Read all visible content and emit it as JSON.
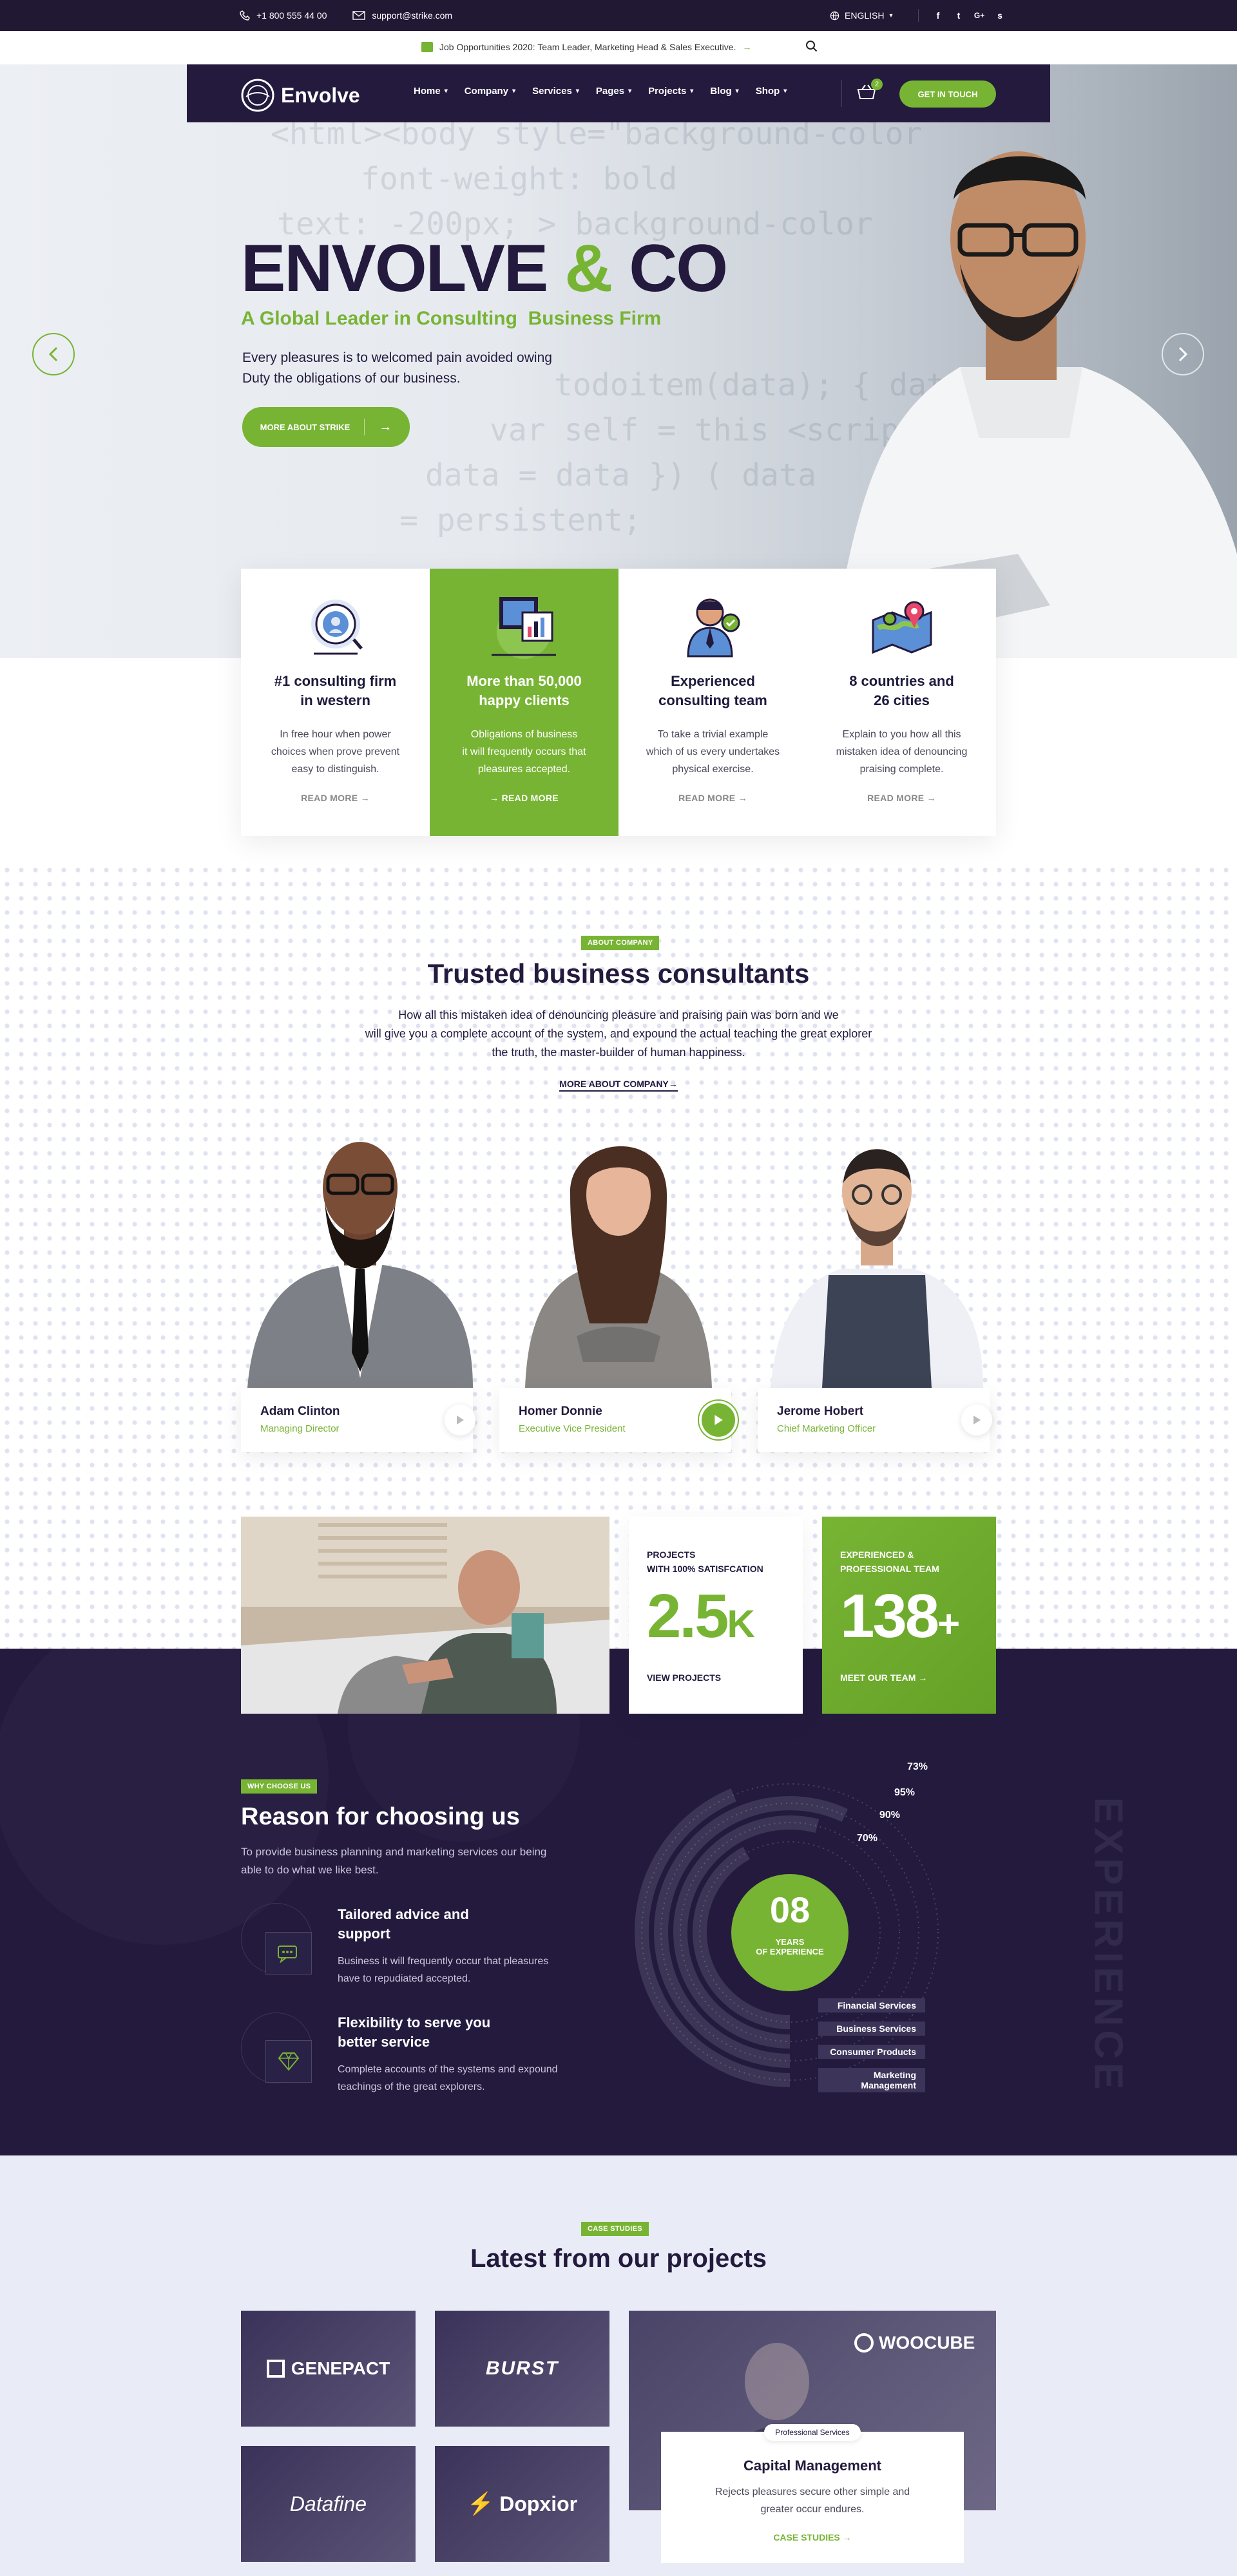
{
  "topbar": {
    "phone": "+1 800 555 44 00",
    "email": "support@strike.com",
    "language": "ENGLISH",
    "socials": [
      "f",
      "t",
      "G+",
      "s"
    ]
  },
  "announcement": {
    "text": "Job Opportunities 2020: Team Leader, Marketing Head & Sales Executive.",
    "arrow": "→"
  },
  "nav": {
    "logo": "Envolve",
    "items": [
      "Home",
      "Company",
      "Services",
      "Pages",
      "Projects",
      "Blog",
      "Shop"
    ],
    "cart_count": "2",
    "cta": "GET IN TOUCH"
  },
  "hero": {
    "title_a": "ENVOLVE",
    "title_amp": "&",
    "title_b": "CO",
    "subtitle": "A Global Leader in Consulting  Business Firm",
    "text1": "Every pleasures is to welcomed pain avoided owing",
    "text2": "Duty the obligations of our business.",
    "button": "MORE ABOUT STRIKE",
    "code_lines": [
      "<html><body style=\"background-color",
      "font-weight: bold",
      "text: -200px; > background-color",
      "todoitem(data); { data: }",
      "var  self = this <script/>",
      "data = data }) ( data",
      "= persistent;"
    ]
  },
  "features": [
    {
      "title1": "#1 consulting firm",
      "title2": "in western",
      "p1": "In free hour when power",
      "p2": "choices when prove prevent",
      "p3": "easy to distinguish.",
      "link": "READ MORE",
      "icon": "target-search-icon"
    },
    {
      "title1": "More than 50,000",
      "title2": "happy clients",
      "p1": "Obligations of business",
      "p2": "it will frequently occurs that",
      "p3": "pleasures accepted.",
      "link": "READ MORE",
      "icon": "dashboard-icon"
    },
    {
      "title1": "Experienced",
      "title2": "consulting team",
      "p1": "To take a trivial example",
      "p2": "which of us every undertakes",
      "p3": "physical exercise.",
      "link": "READ MORE",
      "icon": "consultant-icon"
    },
    {
      "title1": "8 countries and",
      "title2": "26 cities",
      "p1": "Explain to you how all this",
      "p2": "mistaken idea of denouncing",
      "p3": "praising complete.",
      "link": "READ MORE",
      "icon": "map-pin-icon"
    }
  ],
  "about": {
    "tag": "ABOUT COMPANY",
    "title": "Trusted business consultants",
    "text1": "How all this mistaken idea of denouncing pleasure and praising pain was born and we",
    "text2": "will give you a complete account of the system, and expound the actual teaching the great explorer",
    "text3": "the truth, the master-builder of human happiness.",
    "link": "MORE ABOUT COMPANY→"
  },
  "team": [
    {
      "name": "Adam Clinton",
      "role": "Managing Director"
    },
    {
      "name": "Homer Donnie",
      "role": "Executive Vice President"
    },
    {
      "name": "Jerome Hobert",
      "role": "Chief Marketing Officer"
    }
  ],
  "stats": {
    "projects_label1": "PROJECTS",
    "projects_label2": "WITH 100% SATISFCATION",
    "projects_value": "2.5",
    "projects_suffix": "K",
    "projects_link": "VIEW PROJECTS",
    "team_label1": "EXPERIENCED &",
    "team_label2": "PROFESSIONAL TEAM",
    "team_value": "138",
    "team_suffix": "+",
    "team_link": "MEET OUR TEAM →"
  },
  "why": {
    "tag": "WHY CHOOSE US",
    "title": "Reason for choosing us",
    "text1": "To provide business planning and marketing services our being",
    "text2": "able to do what we like best.",
    "items": [
      {
        "t1": "Tailored advice and",
        "t2": "support",
        "d1": "Business it will frequently occur that pleasures",
        "d2": "have to repudiated accepted.",
        "icon": "chat-icon"
      },
      {
        "t1": "Flexibility to serve you",
        "t2": "better service",
        "d1": "Complete accounts of the systems and expound",
        "d2": "teachings of the great explorers.",
        "icon": "diamond-icon"
      }
    ],
    "experience_number": "08",
    "experience_label1": "YEARS",
    "experience_label2": "OF EXPERIENCE",
    "watermark": "EXPERIENCE",
    "rings": [
      {
        "percent": "73%",
        "label": "Financial Services",
        "value": 0.73
      },
      {
        "percent": "95%",
        "label": "Business Services",
        "value": 0.95
      },
      {
        "percent": "90%",
        "label": "Consumer Products",
        "value": 0.9
      },
      {
        "percent": "70%",
        "label": "Marketing Management",
        "value": 0.7
      }
    ]
  },
  "projects": {
    "tag": "CASE STUDIES",
    "title": "Latest from our projects",
    "logos": [
      "GENEPACT",
      "BURST",
      "Datafine",
      "Dopxior"
    ],
    "featured_logo": "WOOCUBE",
    "featured_tag": "Professional Services",
    "featured_title": "Capital Management",
    "featured_text1": "Rejects pleasures secure other simple and",
    "featured_text2": "greater occur endures.",
    "featured_link": "CASE STUDIES"
  },
  "colors": {
    "green": "#78b434",
    "navy": "#231a3e"
  }
}
